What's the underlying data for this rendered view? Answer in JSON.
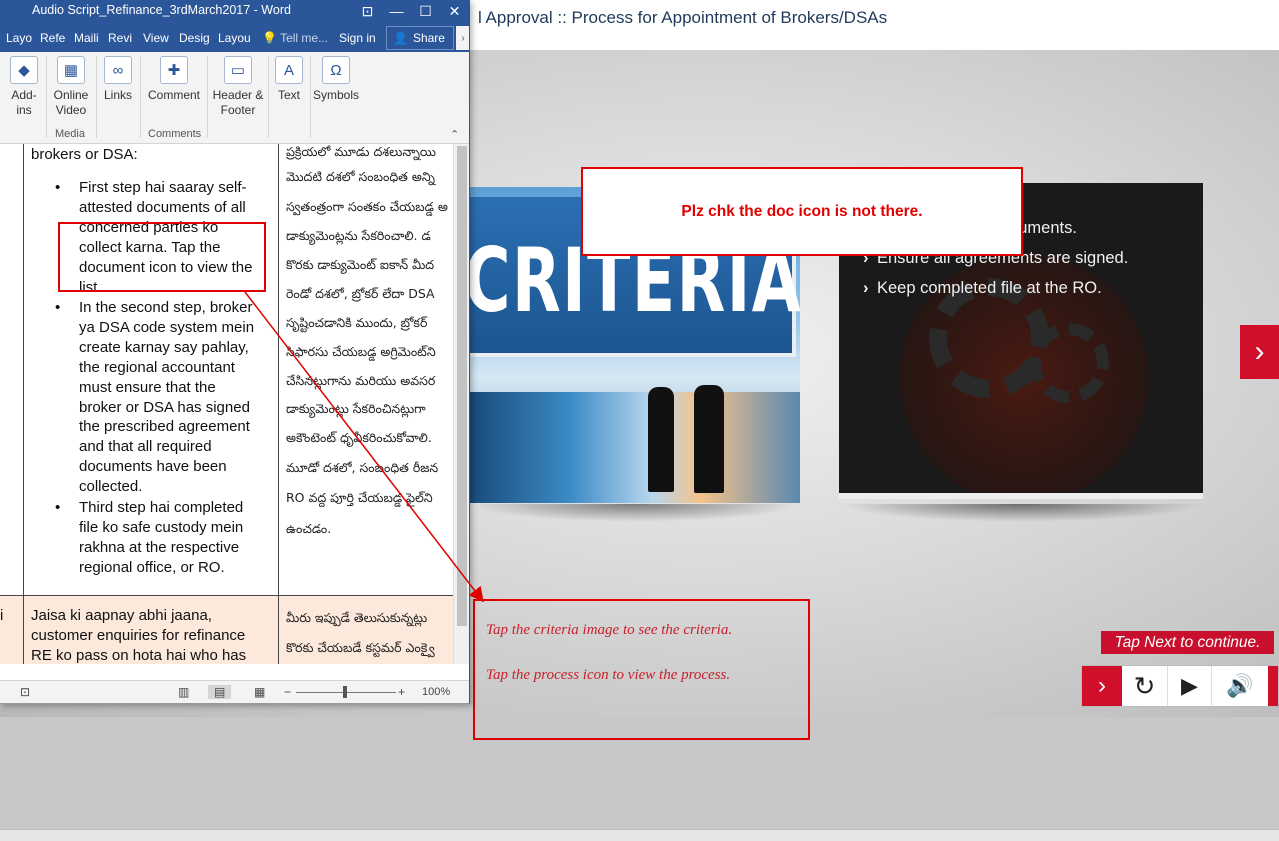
{
  "course": {
    "title": "l Approval :: Process for Appointment of Brokers/DSAs",
    "criteria_word": "CRITERIA",
    "process_points": [
      "Attach attested documents.",
      "Ensure all agreements are signed.",
      "Keep completed file at the RO."
    ],
    "tap_next": "Tap Next to continue.",
    "instructions": [
      "Tap the criteria image to see the criteria.",
      "Tap the process icon to view the process."
    ],
    "controls": {
      "next_icon": "chevron-right-icon",
      "replay_icon": "replay-icon",
      "play_icon": "play-icon",
      "volume_icon": "volume-icon"
    }
  },
  "review": {
    "comment": "Plz chk the doc icon is not there."
  },
  "word": {
    "title": "Audio Script_Refinance_3rdMarch2017 - Word",
    "tabs": [
      "Layo",
      "Refe",
      "Maili",
      "Revi",
      "View",
      "Desig",
      "Layou"
    ],
    "tell_me": "Tell me...",
    "sign_in": "Sign in",
    "share": "Share",
    "ribbon": {
      "addins": "Add-\nins",
      "online_video": "Online\nVideo",
      "links": "Links",
      "comment": "Comment",
      "header_footer": "Header &\nFooter",
      "text": "Text",
      "symbols": "Symbols",
      "group_media": "Media",
      "group_comments": "Comments"
    },
    "doc": {
      "intro": "brokers or DSA:",
      "bullets": [
        [
          "First step hai saaray self-",
          "attested documents of all",
          "concerned parties ko",
          "collect karna. Tap the",
          "document icon to view the",
          "list"
        ],
        [
          "In the second step, broker",
          "ya DSA code system mein",
          "create karnay say pahlay,",
          "the regional accountant",
          "must ensure that the",
          "broker or DSA has signed",
          "the prescribed agreement",
          "and that all required",
          "documents have been",
          "collected."
        ],
        [
          "Third step hai completed",
          "file ko safe custody mein",
          "rakhna at the respective",
          "regional office, or RO."
        ]
      ],
      "telugu_lines": [
        "ప్రక్రియలో మూడు దశలున్నాయి",
        "మొదటి దశలో సంబంధిత అన్ని",
        "స్వతంత్రంగా సంతకం చేయబడ్డ అ",
        "డాక్యుమెంట్లను సేకరించాలి. డ",
        "కొరకు డాక్యుమెంట్ ఐకాన్ మీద",
        "రెండో దశలో, బ్రోకర్ లేదా DSA",
        "సృష్టించడానికి ముందు, బ్రోకర్",
        "సిఫారసు చేయబడ్డ అగ్రిమెంట్‌ని",
        "చేసినట్లుగాను మరియు అవసర",
        "డాక్యుమెంట్లు సేకరించినట్లుగా",
        "అకౌంటెంట్ ధృవీకరించుకోవాలి.",
        "మూడో దశలో, సంబంధిత రీజన",
        "RO వద్ద పూర్తి చేయబడ్డ ఫైల్‌ని",
        "ఉంచడం."
      ],
      "row2_left_fragment": "i",
      "row2_lines": [
        "Jaisa ki aapnay abhi jaana,",
        "customer enquiries for refinance",
        "RE ko pass on hota hai who has"
      ],
      "row2_telugu": [
        "మీరు ఇప్పుడే తెలుసుకున్నట్లు",
        "కొరకు చేయబడే కస్టమర్ ఎంక్వై"
      ]
    },
    "zoom": "100%"
  }
}
